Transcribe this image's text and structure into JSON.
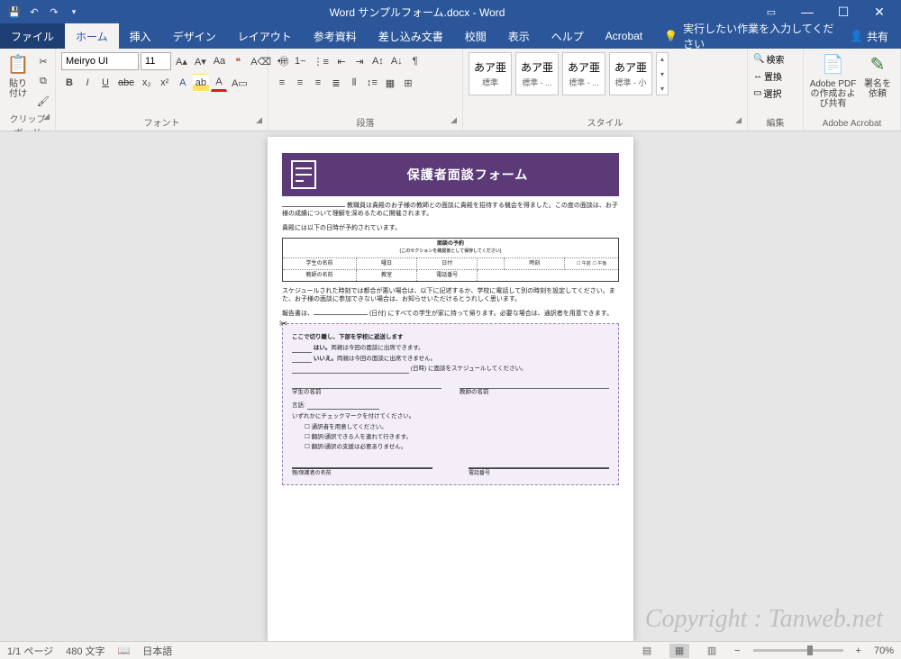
{
  "title": "Word サンプルフォーム.docx - Word",
  "tabs": {
    "file": "ファイル",
    "home": "ホーム",
    "insert": "挿入",
    "design": "デザイン",
    "layout": "レイアウト",
    "references": "参考資料",
    "mailings": "差し込み文書",
    "review": "校閲",
    "view": "表示",
    "help": "ヘルプ",
    "acrobat": "Acrobat",
    "tell_me": "実行したい作業を入力してください",
    "share": "共有"
  },
  "ribbon": {
    "clipboard": {
      "label": "クリップボード",
      "paste": "貼り付け"
    },
    "font": {
      "label": "フォント",
      "name": "Meiryo UI",
      "size": "11"
    },
    "paragraph": {
      "label": "段落"
    },
    "styles": {
      "label": "スタイル",
      "sample": "あア亜",
      "normal": "標準",
      "v1": "標準 - ...",
      "v2": "標準 - ...",
      "v3": "標準 - 小"
    },
    "editing": {
      "label": "編集",
      "find": "検索",
      "replace": "置換",
      "select": "選択"
    },
    "adobe": {
      "label": "Adobe Acrobat",
      "create": "Adobe PDF の作成および共有",
      "sign": "署名を依頼"
    }
  },
  "doc": {
    "banner_title": "保護者面談フォーム",
    "p1_suffix": "教職員は貴殿のお子様の教師との面談に貴殿を招待する機会を得ました。この度の面談は、お子様の成績について理解を深めるために開催されます。",
    "p2": "貴殿には以下の日時が予約されています。",
    "res_title": "面談の予約",
    "res_note": "(このセクションを確認後として保存してください)",
    "cols": {
      "student": "学生の名前",
      "day": "曜日",
      "date": "日付",
      "time": "時刻",
      "am": "午前",
      "pm": "午後",
      "teacher": "教師の名前",
      "room": "教室",
      "phone": "電話番号"
    },
    "p3": "スケジュールされた時刻では都合が悪い場合は、以下に記述するか、学校に電話して別の時刻を設定してください。また、お子様の面談に参加できない場合は、お知らせいただけるとうれしく思います。",
    "p4_a": "報告書は、",
    "p4_b": "(日付) にすべての学生が家に持って帰ります。必要な場合は、通訳者を用意できます。",
    "tear": {
      "title": "ここで切り離し、下部を学校に返送します",
      "yes": "はい。両親は今回の面談に出席できます。",
      "no": "いいえ。両親は今回の面談に出席できません。",
      "resched": "(日時) に面談をスケジュールしてください。",
      "student": "学生の名前",
      "teacher": "教師の名前",
      "reason": "言語:",
      "chk_title": "いずれかにチェックマークを付けてください。",
      "c1": "通訳者を用意してください。",
      "c2": "翻訳/通訳できる人を連れて行きます。",
      "c3": "翻訳/通訳の支援は必要ありません。",
      "guardian": "親/保護者の名前",
      "phone": "電話番号"
    }
  },
  "status": {
    "page": "1/1 ページ",
    "words": "480 文字",
    "lang": "日本語",
    "zoom": "70%"
  },
  "watermark": "Copyright : Tanweb.net"
}
